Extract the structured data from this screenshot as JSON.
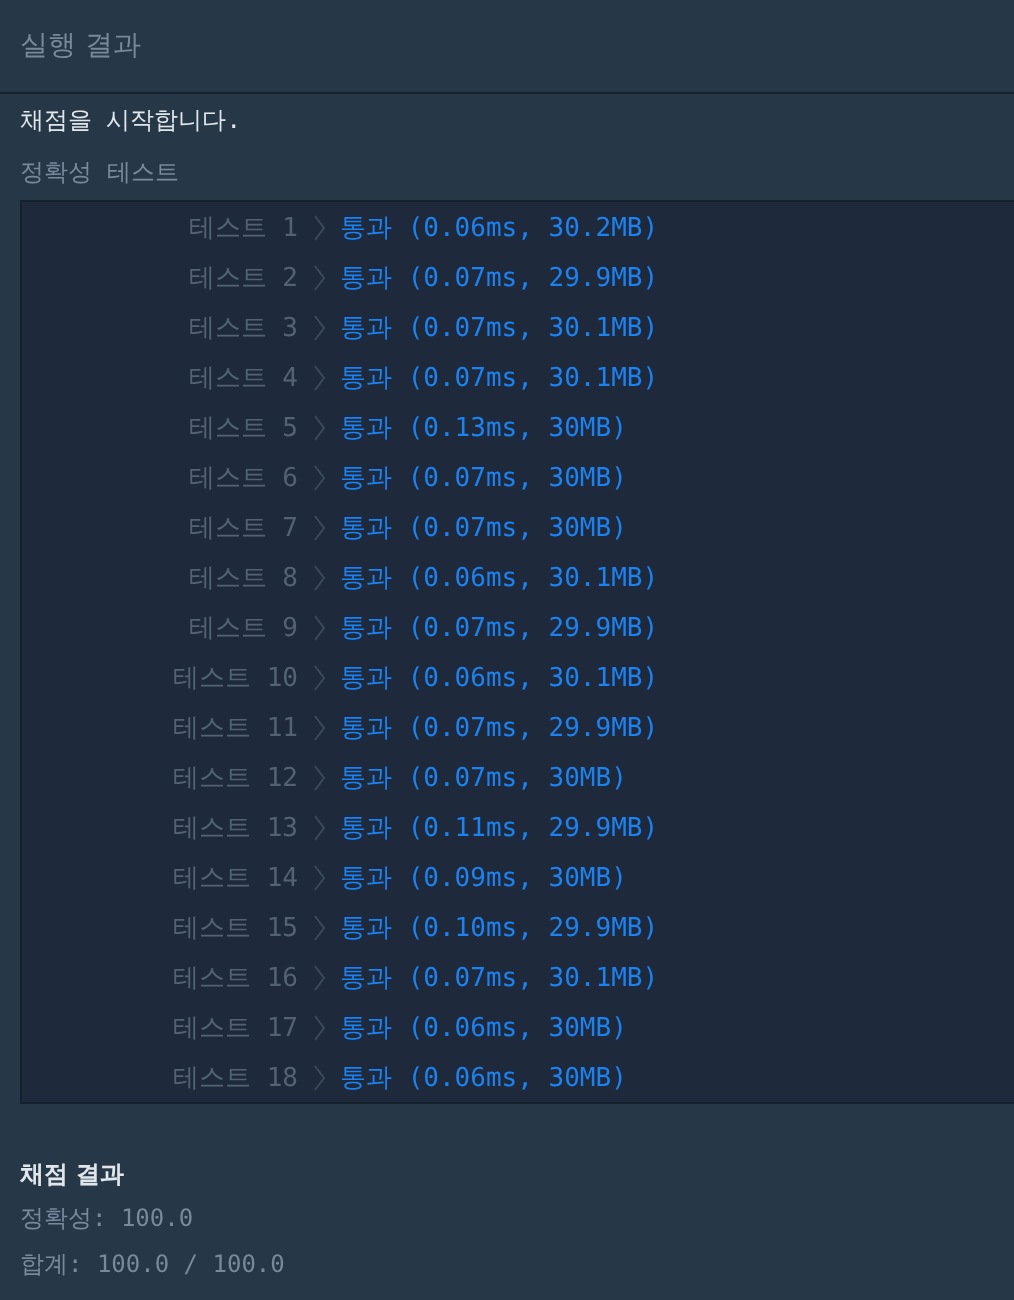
{
  "header": {
    "title": "실행 결과"
  },
  "console": {
    "message": "채점을 시작합니다.",
    "section_heading": "정확성  테스트",
    "tests": [
      {
        "label": "테스트 1",
        "result": "통과 (0.06ms, 30.2MB)"
      },
      {
        "label": "테스트 2",
        "result": "통과 (0.07ms, 29.9MB)"
      },
      {
        "label": "테스트 3",
        "result": "통과 (0.07ms, 30.1MB)"
      },
      {
        "label": "테스트 4",
        "result": "통과 (0.07ms, 30.1MB)"
      },
      {
        "label": "테스트 5",
        "result": "통과 (0.13ms, 30MB)"
      },
      {
        "label": "테스트 6",
        "result": "통과 (0.07ms, 30MB)"
      },
      {
        "label": "테스트 7",
        "result": "통과 (0.07ms, 30MB)"
      },
      {
        "label": "테스트 8",
        "result": "통과 (0.06ms, 30.1MB)"
      },
      {
        "label": "테스트 9",
        "result": "통과 (0.07ms, 29.9MB)"
      },
      {
        "label": "테스트 10",
        "result": "통과 (0.06ms, 30.1MB)"
      },
      {
        "label": "테스트 11",
        "result": "통과 (0.07ms, 29.9MB)"
      },
      {
        "label": "테스트 12",
        "result": "통과 (0.07ms, 30MB)"
      },
      {
        "label": "테스트 13",
        "result": "통과 (0.11ms, 29.9MB)"
      },
      {
        "label": "테스트 14",
        "result": "통과 (0.09ms, 30MB)"
      },
      {
        "label": "테스트 15",
        "result": "통과 (0.10ms, 29.9MB)"
      },
      {
        "label": "테스트 16",
        "result": "통과 (0.07ms, 30.1MB)"
      },
      {
        "label": "테스트 17",
        "result": "통과 (0.06ms, 30MB)"
      },
      {
        "label": "테스트 18",
        "result": "통과 (0.06ms, 30MB)"
      }
    ],
    "summary_heading": "채점 결과",
    "accuracy": "정확성: 100.0",
    "total": "합계: 100.0 / 100.0"
  }
}
